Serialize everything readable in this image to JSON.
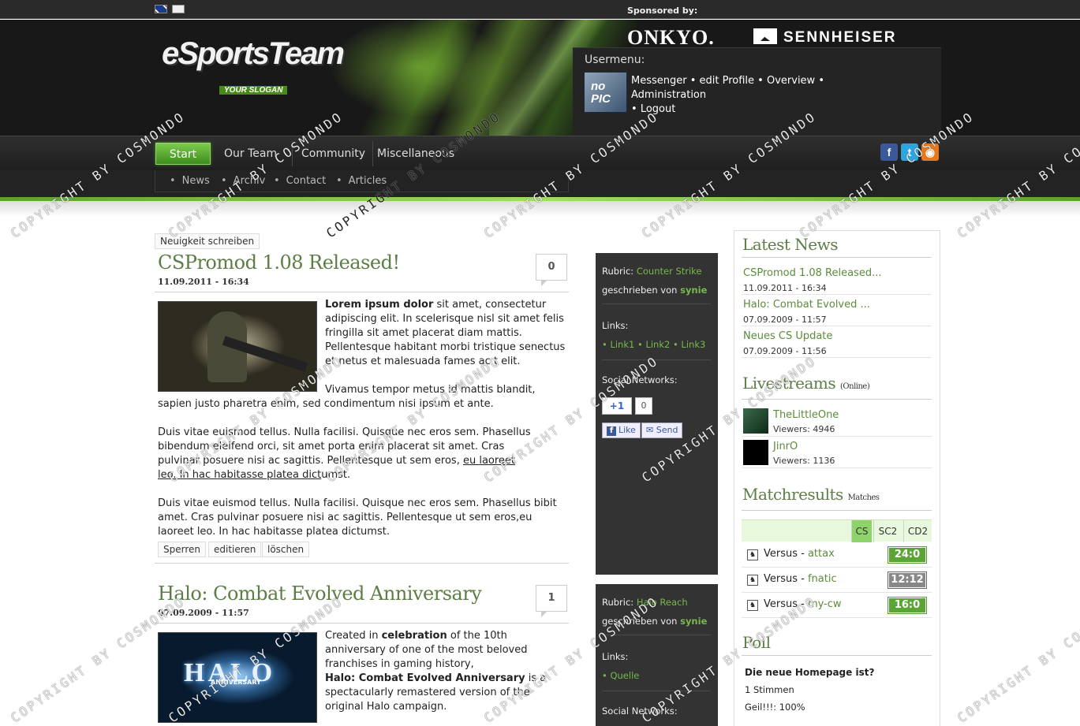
{
  "header": {
    "sponsored_label": "Sponsored by:",
    "sponsor1": "ONKYO.",
    "sponsor2": "SENNHEISER",
    "logo": "eSportsTeam",
    "slogan": "YOUR SLOGAN",
    "languages": [
      "en",
      "de"
    ]
  },
  "usermenu": {
    "title": "Usermenu:",
    "avatar_text": "no PIC",
    "links": [
      "Messenger",
      "edit Profile",
      "Overview",
      "Administration",
      "Logout"
    ]
  },
  "nav": {
    "items": [
      "Start",
      "Our Team",
      "Community",
      "Miscellaneous"
    ],
    "active": "Start",
    "sub_items": [
      "News",
      "Archiv",
      "Contact",
      "Articles"
    ],
    "social": [
      "facebook-icon",
      "twitter-icon",
      "rss-icon"
    ]
  },
  "content": {
    "write_news_button": "Neuigkeit schreiben",
    "news": [
      {
        "title": "CSPromod 1.08 Released!",
        "date": "11.09.2011 - 16:34",
        "comments": "0",
        "p1_bold": "Lorem ipsum dolor",
        "p1": " sit amet, consectetur adipiscing elit. In scelerisque nisl sit amet felis fringilla sit amet placerat diam mattis. Pellentesque habitant morbi tristique senectus et netus et malesuada fames ac t elit.",
        "p2": "Vivamus tempor metus id mattis blandit, sapien justo pharetra enim, sed condimentum nisi ipsum et ante.",
        "p3_pre": "Duis vitae euismod tellus. Nulla facilisi. Quisque nec eros sem. Phasellus bibendum eleifend orci, sit amet porta enim placerat sit amet. Cras pulvinar posuere nisi ac sagittis. Pellentesque ut sem eros, ",
        "p3_link": "eu laoreet leo. In hac habitasse platea dict",
        "p3_post": "umst.",
        "p4": "Duis vitae euismod tellus. Nulla facilisi. Quisque nec eros sem. Phasellus bibit amet. Cras pulvinar posuere nisi ac sagittis. Pellentesque ut sem eros,eu laoreet leo. In hac habitasse platea dictumst.",
        "actions": [
          "Sperren",
          "editieren",
          "löschen"
        ],
        "rubric_label": "Rubric:",
        "rubric": "Counter Strike",
        "author_label": "geschrieben von",
        "author": "synie",
        "links_label": "Links:",
        "links": [
          "Link1",
          "Link2",
          "Link3"
        ],
        "social_label": "Social Networks:",
        "gplus": "+1",
        "gplus_count": "0",
        "like": "Like",
        "send": "Send"
      },
      {
        "title": "Halo: Combat Evolved Anniversary",
        "date": "07.09.2009 - 11:57",
        "comments": "1",
        "p1_pre": "Created in ",
        "p1_bold": "celebration",
        "p1": " of the 10th anniversary of one of the most beloved franchises in gaming history,",
        "p2_bold": "Halo: Combat Evolved Anniversary",
        "p2": " is a spectacularly remastered version of the original Halo campaign.",
        "image_text": "HALO",
        "image_sub": "ANNIVERSARY",
        "rubric_label": "Rubric:",
        "rubric": "Halo Reach",
        "author_label": "geschrieben von",
        "author": "synie",
        "links_label": "Links:",
        "links": [
          "Quelle"
        ],
        "social_label": "Social Networks:"
      }
    ]
  },
  "sidebar": {
    "latest_news": {
      "title": "Latest News",
      "items": [
        {
          "title": "CSPromod 1.08 Released...",
          "date": "11.09.2011 - 16:34"
        },
        {
          "title": "Halo: Combat Evolved ...",
          "date": "07.09.2009 - 11:57"
        },
        {
          "title": "Neues CS Update",
          "date": "07.09.2009 - 11:56"
        }
      ]
    },
    "livestreams": {
      "title": "Livestreams",
      "subtitle": "(Online)",
      "items": [
        {
          "name": "TheLittleOne",
          "viewers": "Viewers: 4946"
        },
        {
          "name": "JinrO",
          "viewers": "Viewers: 1136"
        }
      ]
    },
    "matches": {
      "title": "Matchresults",
      "subtitle": "Matches",
      "tabs": [
        "CS",
        "SC2",
        "CD2"
      ],
      "active_tab": "CS",
      "items": [
        {
          "label": "Versus - ",
          "opponent": "attax",
          "score": "24:0",
          "result": "win"
        },
        {
          "label": "Versus - ",
          "opponent": "fnatic",
          "score": "12:12",
          "result": "draw"
        },
        {
          "label": "Versus - ",
          "opponent": "my-cw",
          "score": "16:0",
          "result": "win"
        }
      ]
    },
    "poll": {
      "title": "Poll",
      "question": "Die neue Homepage ist?",
      "votes": "1 Stimmen",
      "option": "Geil!!!: 100%"
    }
  },
  "watermark": "COPYRIGHT BY COSMONDO",
  "colors": {
    "accent": "#5c7d46",
    "link": "#5c8a3a",
    "nav_active": "#5aa534",
    "dark_column": "#333333"
  }
}
